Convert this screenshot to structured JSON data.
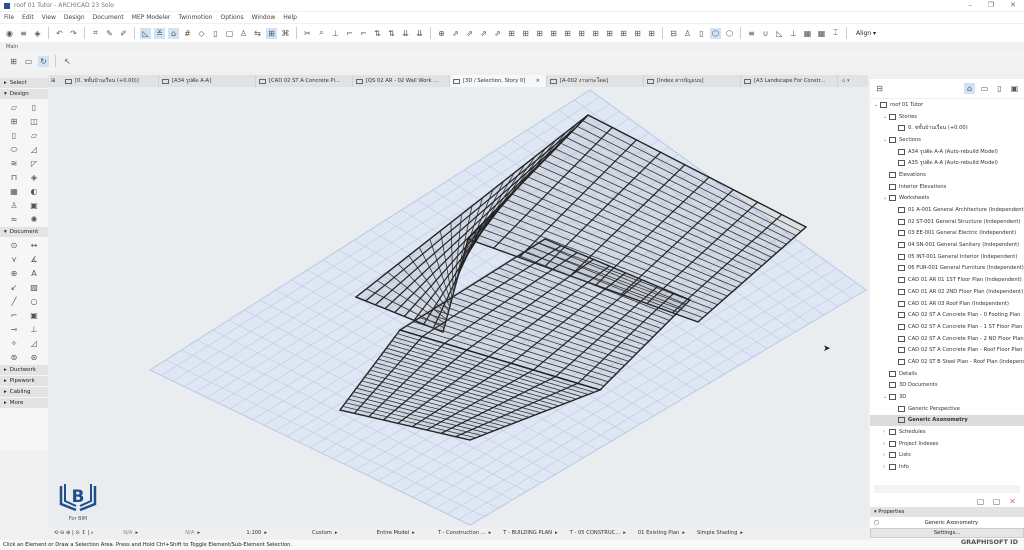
{
  "window": {
    "title": "roof 01 Tutor - ARCHICAD 23 Solo",
    "min": "–",
    "max": "❐",
    "close": "✕"
  },
  "menu": [
    "File",
    "Edit",
    "View",
    "Design",
    "Document",
    "MEP Modeler",
    "Twinmotion",
    "Options",
    "Window",
    "Help"
  ],
  "toolbar": {
    "align_label": "Align ▾",
    "main_label": "Main"
  },
  "tabs": [
    {
      "label": "[0. ชชั้นบ้านเรือน (+0.00)]",
      "active": false
    },
    {
      "label": "[A34 รูปตัด A-A]",
      "active": false
    },
    {
      "label": "[CAD 02 ST A Concrete Pl...",
      "active": false
    },
    {
      "label": "[QS 02 AR - 02 Wall Work ...",
      "active": false
    },
    {
      "label": "[3D / Selection, Story 0]",
      "active": true,
      "close": "×"
    },
    {
      "label": "[A-002 งานกระโดด]",
      "active": false
    },
    {
      "label": "[Index สารบัญแบบ]",
      "active": false
    },
    {
      "label": "[A3 Landscape For Constr...",
      "active": false
    }
  ],
  "toolbox": {
    "groups": [
      {
        "label": "Select",
        "expanded": false
      },
      {
        "label": "Design",
        "expanded": true,
        "icons": [
          "wall-icon",
          "door-icon",
          "window-icon",
          "corner-window-icon",
          "column-icon",
          "beam-icon",
          "slab-icon",
          "roof-icon",
          "stair-icon",
          "shell-icon",
          "railing-icon",
          "mesh-icon",
          "curtain-wall-icon",
          "morph-icon",
          "object-icon",
          "zone-icon",
          "landscape-icon",
          "lamp-icon"
        ]
      },
      {
        "label": "Document",
        "expanded": true,
        "icons": [
          "level-icon",
          "dimension-icon",
          "elevation-icon",
          "angle-icon",
          "radial-icon",
          "text-icon",
          "label-icon",
          "fill-icon",
          "line-icon",
          "circle-icon",
          "polyline-icon",
          "drawing-icon",
          "section-icon",
          "elevation-marker-icon",
          "change-icon",
          "worksheet-icon",
          "detail-icon",
          "camera-icon"
        ]
      },
      {
        "label": "Ductwork",
        "expanded": false
      },
      {
        "label": "Pipework",
        "expanded": false
      },
      {
        "label": "Cabling",
        "expanded": false
      },
      {
        "label": "More",
        "expanded": false
      }
    ]
  },
  "navigator": {
    "items": [
      {
        "label": "roof 01 Tutor",
        "level": 0,
        "arrow": "v"
      },
      {
        "label": "Stories",
        "level": 1,
        "arrow": "v"
      },
      {
        "label": "0. ชชั้นบ้านเรือน (+0.00)",
        "level": 2,
        "arrow": ""
      },
      {
        "label": "Sections",
        "level": 1,
        "arrow": "v"
      },
      {
        "label": "A34 รูปตัด A-A (Auto-rebuild Model)",
        "level": 2,
        "arrow": ""
      },
      {
        "label": "A35 รูปตัด A-A (Auto-rebuild Model)",
        "level": 2,
        "arrow": ""
      },
      {
        "label": "Elevations",
        "level": 1,
        "arrow": ""
      },
      {
        "label": "Interior Elevations",
        "level": 1,
        "arrow": ""
      },
      {
        "label": "Worksheets",
        "level": 1,
        "arrow": "v"
      },
      {
        "label": "01 A-001 General Architecture (Independent)",
        "level": 2,
        "arrow": ""
      },
      {
        "label": "02 ST-001 General Structure (Independent)",
        "level": 2,
        "arrow": ""
      },
      {
        "label": "03 EE-001 General Electric (Independent)",
        "level": 2,
        "arrow": ""
      },
      {
        "label": "04 SN-001 General Sanitary (Independent)",
        "level": 2,
        "arrow": ""
      },
      {
        "label": "05 INT-001 General Interior (Independent)",
        "level": 2,
        "arrow": ""
      },
      {
        "label": "06 FUR-001 General Furniture (Independent)",
        "level": 2,
        "arrow": ""
      },
      {
        "label": "CAD 01 AR 01 1ST Floor Plan (Independent)",
        "level": 2,
        "arrow": ""
      },
      {
        "label": "CAD 01 AR 02 2ND Floor Plan (Independent)",
        "level": 2,
        "arrow": ""
      },
      {
        "label": "CAD 01 AR 03 Roof Plan (Independent)",
        "level": 2,
        "arrow": ""
      },
      {
        "label": "CAD 02 ST A Concrete Plan - 0 Footing Plan",
        "level": 2,
        "arrow": ""
      },
      {
        "label": "CAD 02 ST A Concrete Plan - 1 ST Floor Plan",
        "level": 2,
        "arrow": ""
      },
      {
        "label": "CAD 02 ST A Concrete Plan - 2 ND Floor Plan",
        "level": 2,
        "arrow": ""
      },
      {
        "label": "CAD 02 ST A Concrete Plan - Roof Floor Plan",
        "level": 2,
        "arrow": ""
      },
      {
        "label": "CAD 02 ST B Steel Plan - Roof Plan (Independent)",
        "level": 2,
        "arrow": ""
      },
      {
        "label": "Details",
        "level": 1,
        "arrow": ""
      },
      {
        "label": "3D Documents",
        "level": 1,
        "arrow": ""
      },
      {
        "label": "3D",
        "level": 1,
        "arrow": "v"
      },
      {
        "label": "Generic Perspective",
        "level": 2,
        "arrow": ""
      },
      {
        "label": "Generic Axonometry",
        "level": 2,
        "arrow": "",
        "selected": true
      },
      {
        "label": "Schedules",
        "level": 1,
        "arrow": ">"
      },
      {
        "label": "Project Indexes",
        "level": 1,
        "arrow": ">"
      },
      {
        "label": "Lists",
        "level": 1,
        "arrow": ">"
      },
      {
        "label": "Info",
        "level": 1,
        "arrow": ">"
      }
    ]
  },
  "properties": {
    "header": "Properties",
    "view_name": "Generic Axonometry",
    "settings_label": "Settings..."
  },
  "bottom": {
    "n_a_1": "N/A",
    "n_a_2": "N/A",
    "scale": "1:100",
    "pen_set": "Custom",
    "model": "Entire Model",
    "layer": "T - Construction ...",
    "view_set": "T - BUILDING PLAN",
    "dim": "T - 05 CONSTRUC...",
    "renovation": "01 Existing Plan",
    "shading": "Simple Shading"
  },
  "status": "Click an Element or Draw a Selection Area. Press and Hold Ctrl+Shift to Toggle Element/Sub-Element Selection.",
  "graphisoft_id": "GRAPHISOFT ID",
  "logo": {
    "letter": "B",
    "text": "For BIM"
  },
  "colors": {
    "accent": "#cfe3f5",
    "grid": "#b8c8e8",
    "roof": "#222222"
  }
}
